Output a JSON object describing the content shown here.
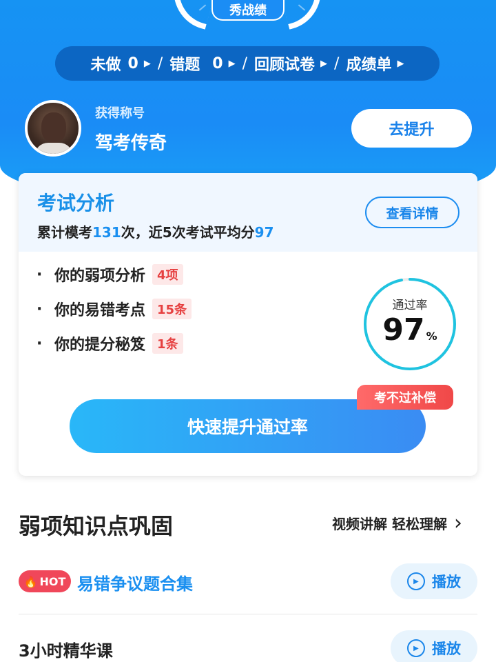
{
  "header": {
    "badge": "秀战绩",
    "stats": [
      {
        "label": "未做",
        "value": "0"
      },
      {
        "label": "错题",
        "value": "0"
      },
      {
        "label": "回顾试卷",
        "value": ""
      },
      {
        "label": "成绩单",
        "value": ""
      }
    ],
    "title_label": "获得称号",
    "title_value": "驾考传奇",
    "improve_button": "去提升"
  },
  "analysis": {
    "title": "考试分析",
    "summary_prefix": "累计模考",
    "exam_count": "131",
    "summary_mid": "次，近5次考试平均分",
    "avg_score": "97",
    "detail_button": "查看详情",
    "items": [
      {
        "label": "你的弱项分析",
        "badge": "4项"
      },
      {
        "label": "你的易错考点",
        "badge": "15条"
      },
      {
        "label": "你的提分秘笈",
        "badge": "1条"
      }
    ],
    "pass_rate_label": "通过率",
    "pass_rate_value": "97",
    "pass_rate_unit": "%",
    "pass_rate_fraction": 0.97,
    "compensation_tag": "考不过补偿",
    "boost_button": "快速提升通过率"
  },
  "weak_section": {
    "title": "弱项知识点巩固",
    "link": "视频讲解 轻松理解",
    "rows": [
      {
        "hot": "HOT",
        "title": "易错争议题合集",
        "button": "播放"
      },
      {
        "title": "3小时精华课",
        "button": "播放"
      }
    ]
  },
  "colors": {
    "brand_blue": "#1a8ff0",
    "header_blue": "#1693f3",
    "alert_red": "#e64040",
    "ring_cyan": "#1fc3e0"
  }
}
